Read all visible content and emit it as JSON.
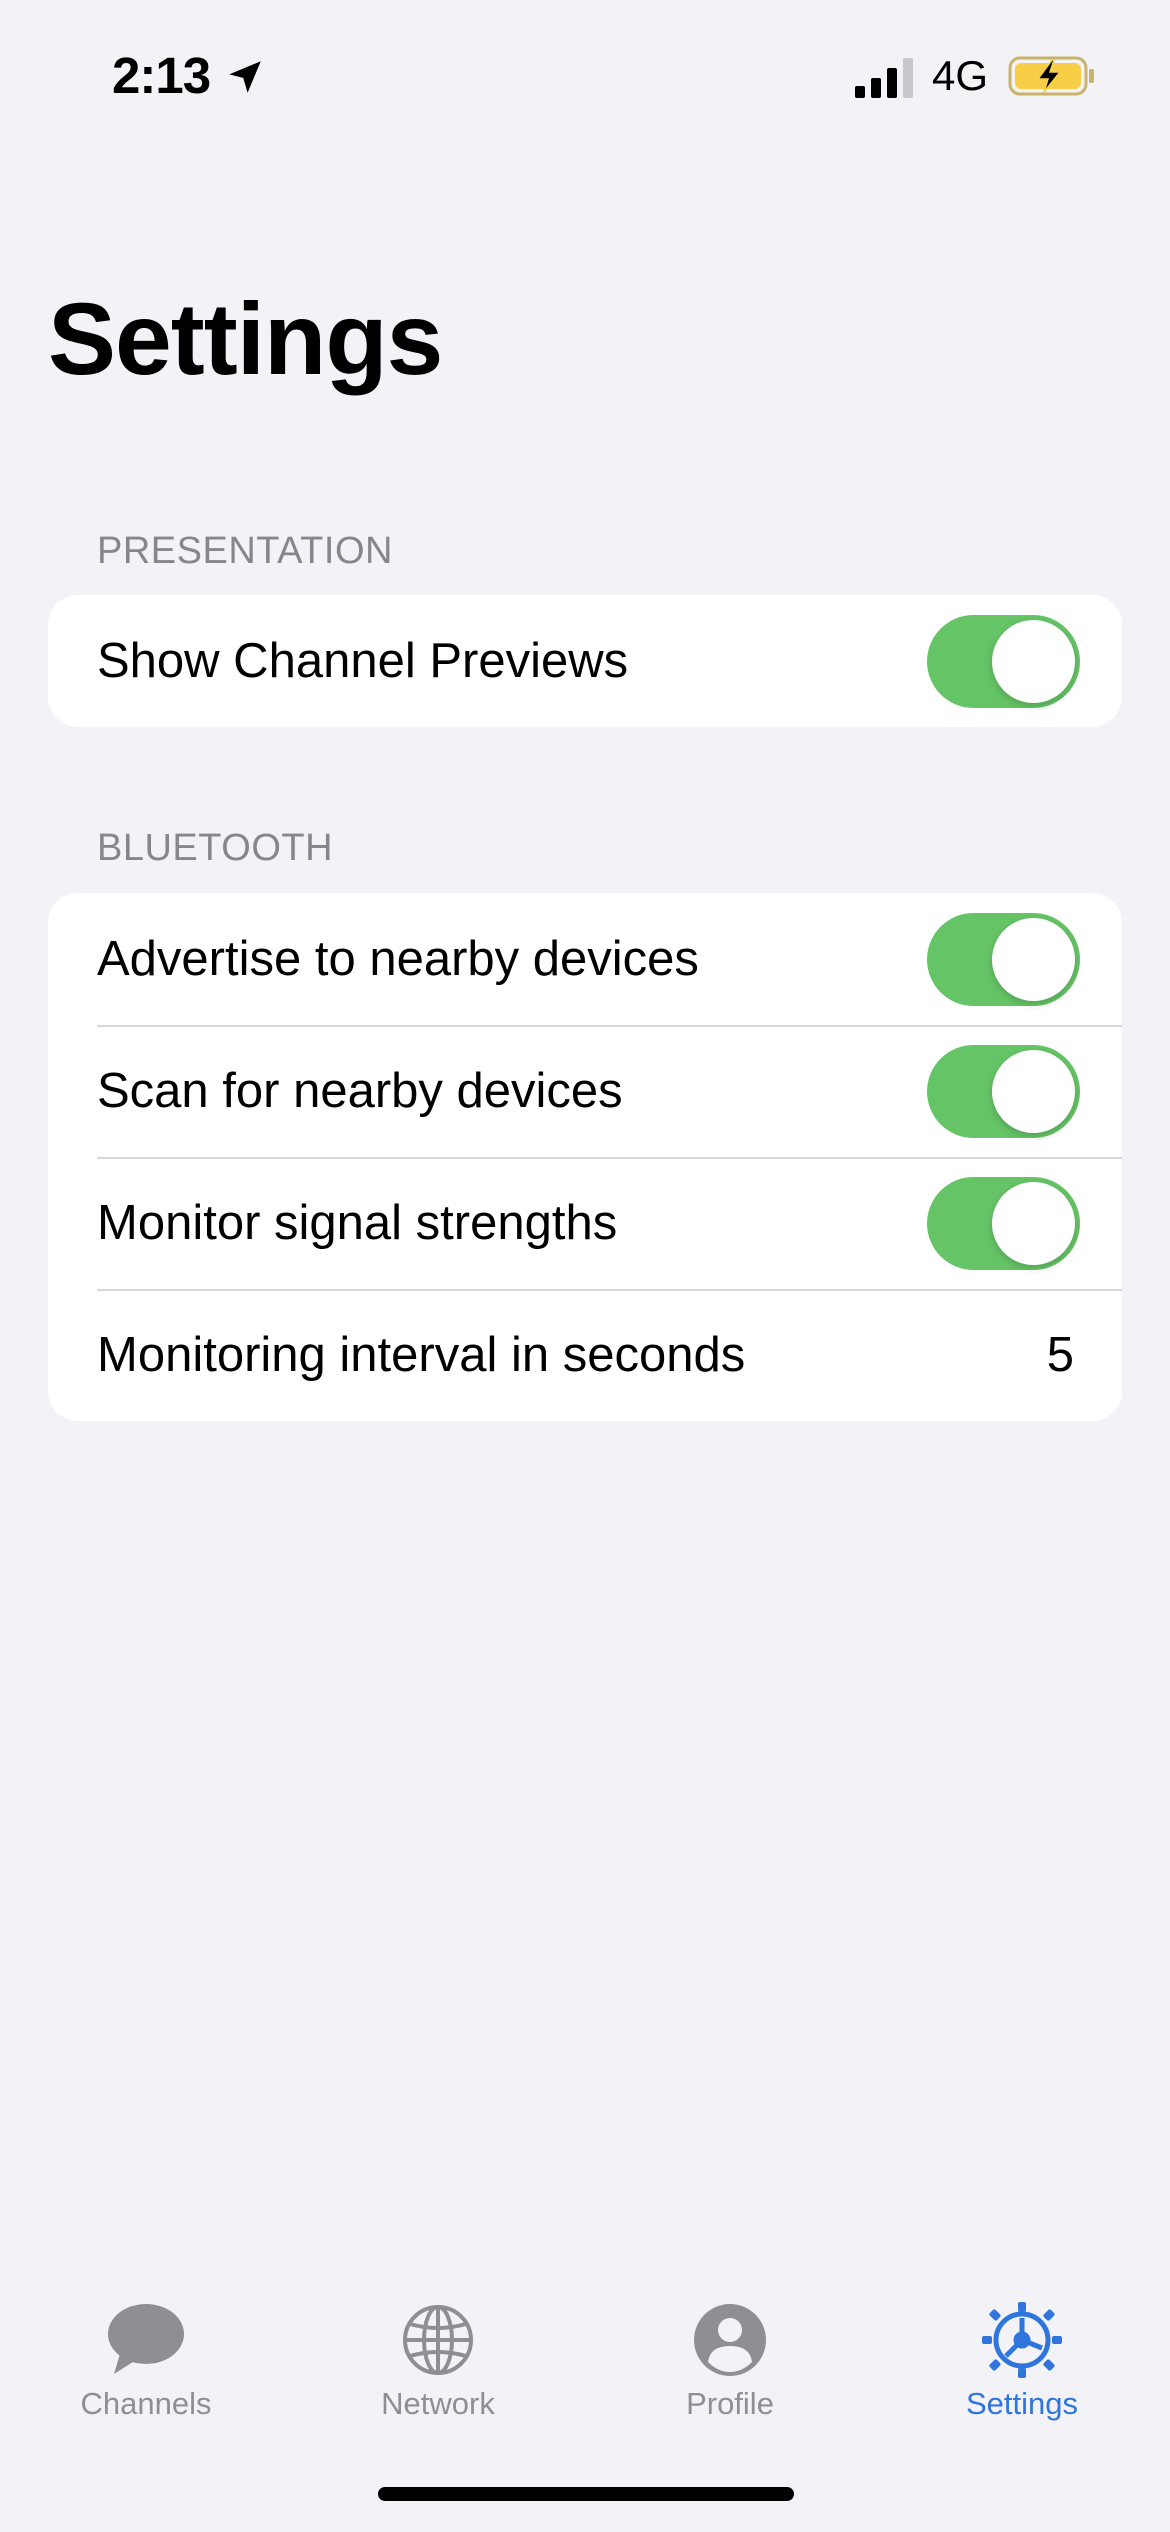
{
  "status_bar": {
    "time": "2:13",
    "network_type": "4G",
    "location_icon": "location-arrow-icon",
    "signal_icon": "cellular-signal-icon",
    "battery_icon": "battery-charging-icon",
    "battery_color": "#f7ce46"
  },
  "title": "Settings",
  "sections": {
    "presentation": {
      "header": "PRESENTATION",
      "rows": [
        {
          "label": "Show Channel Previews",
          "toggle_on": true
        }
      ]
    },
    "bluetooth": {
      "header": "BLUETOOTH",
      "rows": [
        {
          "label": "Advertise to nearby devices",
          "toggle_on": true
        },
        {
          "label": "Scan for nearby devices",
          "toggle_on": true
        },
        {
          "label": "Monitor signal strengths",
          "toggle_on": true
        },
        {
          "label": "Monitoring interval in seconds",
          "value": "5"
        }
      ]
    }
  },
  "tab_bar": {
    "tabs": [
      {
        "label": "Channels",
        "icon": "chat-bubble-icon",
        "active": false
      },
      {
        "label": "Network",
        "icon": "globe-icon",
        "active": false
      },
      {
        "label": "Profile",
        "icon": "person-circle-icon",
        "active": false
      },
      {
        "label": "Settings",
        "icon": "gear-icon",
        "active": true
      }
    ]
  },
  "colors": {
    "toggle_on": "#65c466",
    "accent": "#2f75dc",
    "inactive_tab": "#8e8e93",
    "background": "#f2f2f7"
  }
}
